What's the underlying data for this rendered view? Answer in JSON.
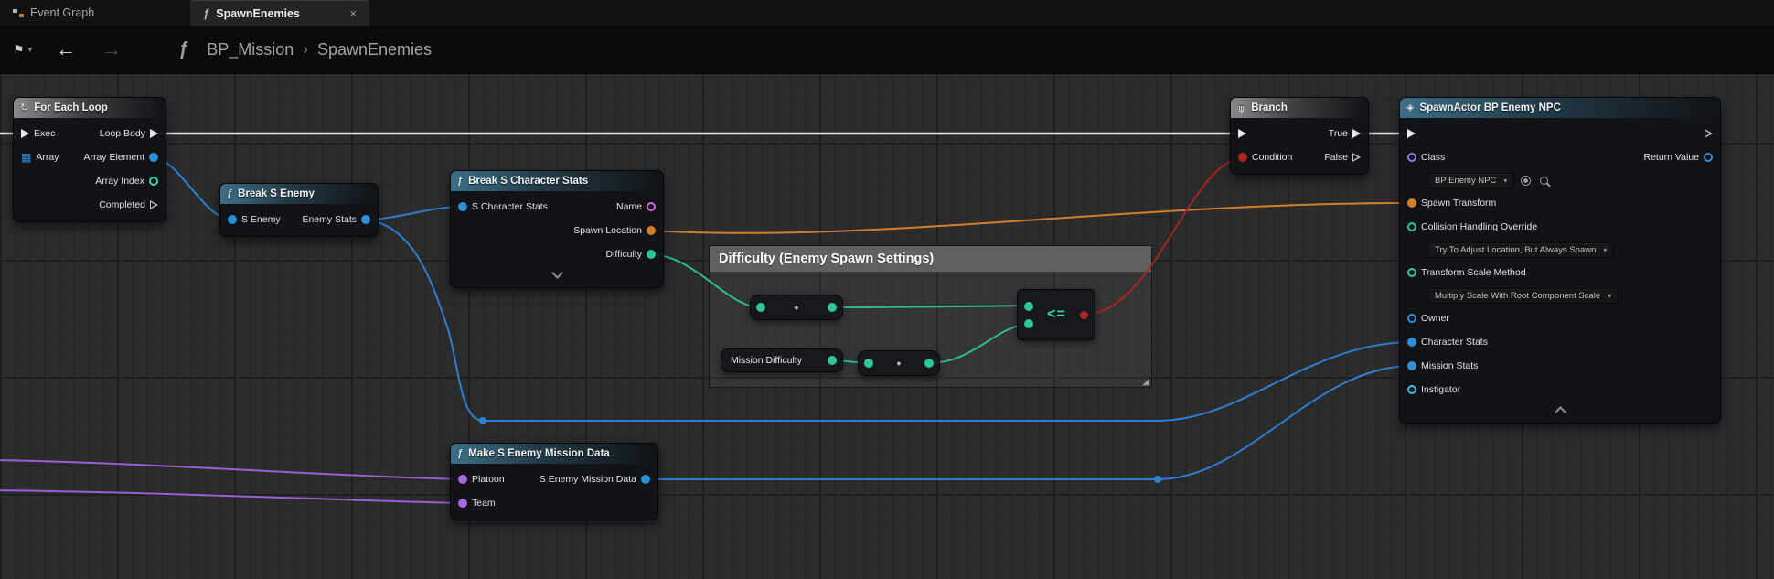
{
  "tab_bar": {
    "event_graph_tab": "Event Graph",
    "spawn_enemies_tab": "SpawnEnemies"
  },
  "toolbar": {
    "breadcrumb_parent": "BP_Mission",
    "breadcrumb_current": "SpawnEnemies"
  },
  "icons": {
    "function_glyph": "ƒ",
    "close_glyph": "×",
    "bookmark_glyph": "⚑",
    "caret_glyph": "▾",
    "back_glyph": "←",
    "forward_glyph": "→",
    "chevron_right_glyph": "›",
    "loop_glyph": "↻",
    "branch_glyph": "⋔",
    "spawn_glyph": "◈",
    "array_grid_glyph": "▦",
    "dropdown_caret": "▾",
    "conversion_dot": "●",
    "resize_glyph": "◢"
  },
  "nodes": {
    "for_each_loop": {
      "title": "For Each Loop",
      "pins": {
        "exec": "Exec",
        "array": "Array",
        "loop_body": "Loop Body",
        "array_element": "Array Element",
        "array_index": "Array Index",
        "completed": "Completed"
      }
    },
    "break_s_enemy": {
      "title": "Break S Enemy",
      "pins": {
        "s_enemy": "S Enemy",
        "enemy_stats": "Enemy Stats"
      }
    },
    "break_s_character_stats": {
      "title": "Break S Character Stats",
      "pins": {
        "s_character_stats": "S Character Stats",
        "name": "Name",
        "spawn_location": "Spawn Location",
        "difficulty": "Difficulty"
      }
    },
    "comment": {
      "title": "Difficulty (Enemy Spawn Settings)"
    },
    "mission_difficulty": {
      "title": "Mission Difficulty"
    },
    "less_equal": {
      "operator": "<="
    },
    "branch": {
      "title": "Branch",
      "pins": {
        "condition": "Condition",
        "true": "True",
        "false": "False"
      }
    },
    "spawn_actor": {
      "title": "SpawnActor BP Enemy NPC",
      "class_value": "BP Enemy NPC",
      "collision_value": "Try To Adjust Location, But Always Spawn",
      "scale_value": "Multiply Scale With Root Component Scale",
      "pins": {
        "class": "Class",
        "return_value": "Return Value",
        "spawn_transform": "Spawn Transform",
        "collision": "Collision Handling Override",
        "scale": "Transform Scale Method",
        "owner": "Owner",
        "character_stats": "Character Stats",
        "mission_stats": "Mission Stats",
        "instigator": "Instigator"
      }
    },
    "make_s_enemy_mission_data": {
      "title": "Make S Enemy Mission Data",
      "pins": {
        "platoon": "Platoon",
        "team": "Team",
        "s_enemy_mission_data": "S Enemy Mission Data"
      }
    }
  },
  "colors": {
    "exec_wire": "#e6e6e6",
    "object_wire": "#2e7fd2",
    "transform_wire": "#cf7f2e",
    "float_wire": "#2dbd8d",
    "bool_wire": "#a32525",
    "byte_wire": "#9a5fd8",
    "object_pin": "#2e8fd9",
    "name_pin": "#d26ad8",
    "class_pin": "#8d7ce8",
    "int_pin": "#36d4ac"
  }
}
